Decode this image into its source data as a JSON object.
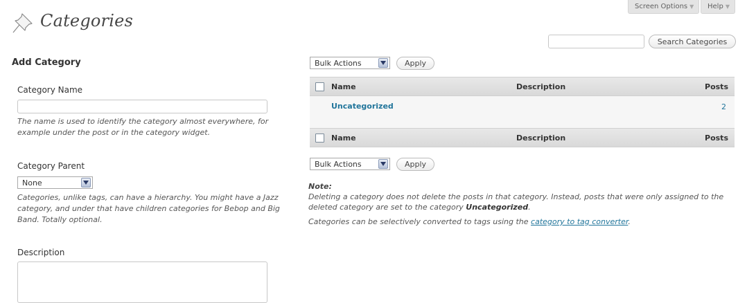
{
  "header": {
    "title": "Categories",
    "icon": "pushpin-icon",
    "screen_options_label": "Screen Options",
    "help_label": "Help"
  },
  "search": {
    "input_value": "",
    "button_label": "Search Categories"
  },
  "add_form": {
    "heading": "Add Category",
    "name_label": "Category Name",
    "name_value": "",
    "name_hint": "The name is used to identify the category almost everywhere, for example under the post or in the category widget.",
    "parent_label": "Category Parent",
    "parent_selected": "None",
    "parent_hint": "Categories, unlike tags, can have a hierarchy. You might have a Jazz category, and under that have children categories for Bebop and Big Band. Totally optional.",
    "description_label": "Description",
    "description_value": ""
  },
  "bulk": {
    "selected": "Bulk Actions",
    "apply_label": "Apply"
  },
  "table": {
    "columns": [
      "Name",
      "Description",
      "Posts"
    ],
    "rows": [
      {
        "name": "Uncategorized",
        "description": "",
        "posts": "2"
      }
    ]
  },
  "note": {
    "title": "Note:",
    "text_before": "Deleting a category does not delete the posts in that category. Instead, posts that were only assigned to the deleted category are set to the category ",
    "bold_category": "Uncategorized",
    "text_after": ".",
    "convert_before": "Categories can be selectively converted to tags using the ",
    "convert_link": "category to tag converter",
    "convert_after": "."
  },
  "colors": {
    "link": "#21759b",
    "table_header": "#dfdfdf",
    "title": "#464646"
  }
}
